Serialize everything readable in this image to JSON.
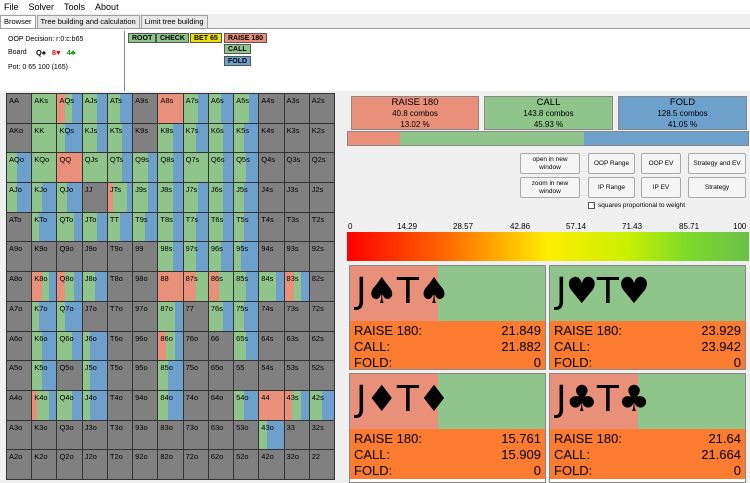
{
  "menu": [
    "File",
    "Solver",
    "Tools",
    "About"
  ],
  "tabs": [
    "Browser",
    "Tree building and calculation",
    "Limit tree building"
  ],
  "info": {
    "decision": "OOP Decision: r:0:c:b65",
    "board_label": "Board",
    "board_cards": [
      {
        "t": "Q♠",
        "c": "b"
      },
      {
        "t": "8♥",
        "c": "r"
      },
      {
        "t": "4♣",
        "c": "g"
      }
    ],
    "pot": "Pot:   0 65 100 (165)"
  },
  "actions": [
    {
      "label": "ROOT",
      "color": "#8fc48a"
    },
    {
      "label": "CHECK",
      "color": "#8fc48a"
    },
    {
      "label": "BET 65",
      "color": "#f0e000"
    },
    {
      "label": "RAISE 180",
      "color": "#e8907a"
    },
    {
      "label": "CALL",
      "color": "#8fc48a"
    },
    {
      "label": "FOLD",
      "color": "#6ea0cc"
    }
  ],
  "summary": [
    {
      "title": "RAISE 180",
      "combos": "40.8 combos",
      "pct": "13.02 %",
      "color": "#e8907a"
    },
    {
      "title": "CALL",
      "combos": "143.8 combos",
      "pct": "45.93 %",
      "color": "#8fc48a"
    },
    {
      "title": "FOLD",
      "combos": "128.5 combos",
      "pct": "41.05 %",
      "color": "#6ea0cc"
    }
  ],
  "mix": [
    {
      "f": 0.13,
      "c": "#e8907a"
    },
    {
      "f": 0.46,
      "c": "#8fc48a"
    },
    {
      "f": 0.41,
      "c": "#6ea0cc"
    }
  ],
  "buttons": {
    "open_new": "open in new window",
    "zoom_new": "zoom in new window",
    "oop_range": "OOP Range",
    "oop_ev": "OOP EV",
    "strategy_ev": "Strategy and EV",
    "ip_range": "IP  Range",
    "ip_ev": "IP  EV",
    "strategy": "Strategy"
  },
  "checkbox": "squares proportional to weight",
  "scale": [
    "0",
    "14.29",
    "28.57",
    "42.86",
    "57.14",
    "71.43",
    "85.71",
    "100"
  ],
  "colors": {
    "raise": "#e8907a",
    "call": "#8fc48a",
    "fold": "#6ea0cc",
    "empty": "#808080"
  },
  "hands": [
    [
      "AA",
      "AKs",
      "AQs",
      "AJs",
      "ATs",
      "A9s",
      "A8s",
      "A7s",
      "A6s",
      "A5s",
      "A4s",
      "A3s",
      "A2s"
    ],
    [
      "AKo",
      "KK",
      "KQs",
      "KJs",
      "KTs",
      "K9s",
      "K8s",
      "K7s",
      "K6s",
      "K5s",
      "K4s",
      "K3s",
      "K2s"
    ],
    [
      "AQo",
      "KQo",
      "QQ",
      "QJs",
      "QTs",
      "Q9s",
      "Q8s",
      "Q7s",
      "Q6s",
      "Q5s",
      "Q4s",
      "Q3s",
      "Q2s"
    ],
    [
      "AJo",
      "KJo",
      "QJo",
      "JJ",
      "JTs",
      "J9s",
      "J8s",
      "J7s",
      "J6s",
      "J5s",
      "J4s",
      "J3s",
      "J2s"
    ],
    [
      "ATo",
      "KTo",
      "QTo",
      "JTo",
      "TT",
      "T9s",
      "T8s",
      "T7s",
      "T6s",
      "T5s",
      "T4s",
      "T3s",
      "T2s"
    ],
    [
      "A9o",
      "K9o",
      "Q9o",
      "J9o",
      "T9o",
      "99",
      "98s",
      "97s",
      "96s",
      "95s",
      "94s",
      "93s",
      "92s"
    ],
    [
      "A8o",
      "K8o",
      "Q8o",
      "J8o",
      "T8o",
      "98o",
      "88",
      "87s",
      "86s",
      "85s",
      "84s",
      "83s",
      "82s"
    ],
    [
      "A7o",
      "K7o",
      "Q7o",
      "J7o",
      "T7o",
      "97o",
      "87o",
      "77",
      "76s",
      "75s",
      "74s",
      "73s",
      "72s"
    ],
    [
      "A6o",
      "K6o",
      "Q6o",
      "J6o",
      "T6o",
      "96o",
      "86o",
      "76o",
      "66",
      "65s",
      "64s",
      "63s",
      "62s"
    ],
    [
      "A5o",
      "K5o",
      "Q5o",
      "J5o",
      "T5o",
      "95o",
      "85o",
      "75o",
      "65o",
      "55",
      "54s",
      "53s",
      "52s"
    ],
    [
      "A4o",
      "K4o",
      "Q4o",
      "J4o",
      "T4o",
      "94o",
      "84o",
      "74o",
      "64o",
      "54o",
      "44",
      "43s",
      "42s"
    ],
    [
      "A3o",
      "K3o",
      "Q3o",
      "J3o",
      "T3o",
      "93o",
      "83o",
      "73o",
      "63o",
      "53o",
      "43o",
      "33",
      "32s"
    ],
    [
      "A2o",
      "K2o",
      "Q2o",
      "J2o",
      "T2o",
      "92o",
      "82o",
      "72o",
      "62o",
      "52o",
      "42o",
      "32o",
      "22"
    ]
  ],
  "cells": {
    "AKs": [
      0,
      1,
      0
    ],
    "AQs": [
      0.3,
      0.3,
      0.4
    ],
    "AJs": [
      0,
      0.6,
      0.4
    ],
    "ATs": [
      0,
      0.5,
      0.5
    ],
    "A8s": [
      1,
      0,
      0
    ],
    "A7s": [
      0,
      0.6,
      0.4
    ],
    "A6s": [
      0,
      0.5,
      0.5
    ],
    "A5s": [
      0,
      0.6,
      0.4
    ],
    "KK": [
      0,
      1,
      0
    ],
    "KQs": [
      0,
      0.3,
      0.7
    ],
    "KJs": [
      0,
      0.6,
      0.4
    ],
    "KTs": [
      0,
      0.6,
      0.4
    ],
    "K8s": [
      0,
      0.6,
      0.4
    ],
    "K7s": [
      0,
      0.5,
      0.5
    ],
    "K6s": [
      0,
      0.6,
      0.4
    ],
    "K5s": [
      0,
      0.4,
      0.6
    ],
    "AQo": [
      0,
      0.4,
      0.6
    ],
    "KQo": [
      0,
      1,
      0
    ],
    "QQ": [
      1,
      0,
      0
    ],
    "QJs": [
      0,
      1,
      0
    ],
    "QTs": [
      0,
      0.6,
      0.4
    ],
    "Q9s": [
      0,
      0.6,
      0.4
    ],
    "Q8s": [
      0,
      0.6,
      0.4
    ],
    "Q7s": [
      0,
      1,
      0
    ],
    "Q6s": [
      0,
      0.6,
      0.4
    ],
    "Q5s": [
      0,
      0.5,
      0.5
    ],
    "AJo": [
      0,
      0.4,
      0.6
    ],
    "KJo": [
      0,
      0.4,
      0.6
    ],
    "QJo": [
      0,
      0.4,
      0.6
    ],
    "JTs": [
      0.2,
      0.6,
      0.2
    ],
    "J9s": [
      0,
      0.6,
      0.4
    ],
    "J8s": [
      0,
      0.6,
      0.4
    ],
    "J7s": [
      0,
      0.6,
      0.4
    ],
    "J6s": [
      0,
      0.6,
      0.4
    ],
    "J5s": [
      0,
      0.4,
      0.6
    ],
    "KTo": [
      0,
      0.3,
      0.7
    ],
    "QTo": [
      0,
      0.7,
      0.3
    ],
    "JTo": [
      0,
      0.6,
      0.4
    ],
    "TT": [
      0,
      0.5,
      0.5
    ],
    "T9s": [
      0,
      0.5,
      0.5
    ],
    "T8s": [
      0,
      0.6,
      0.4
    ],
    "T7s": [
      0,
      0.5,
      0.5
    ],
    "T6s": [
      0,
      0.6,
      0.4
    ],
    "T5s": [
      0,
      0.4,
      0.6
    ],
    "98s": [
      0,
      0.6,
      0.4
    ],
    "97s": [
      0,
      0.5,
      0.5
    ],
    "96s": [
      0,
      0.5,
      0.5
    ],
    "95s": [
      0,
      0.3,
      0.7
    ],
    "K8o": [
      0.4,
      0.3,
      0.3
    ],
    "Q8o": [
      0.3,
      0.4,
      0.3
    ],
    "J8o": [
      0,
      0.5,
      0.5
    ],
    "88": [
      1,
      0,
      0
    ],
    "87s": [
      0.5,
      0.5,
      0
    ],
    "86s": [
      0.4,
      0.6,
      0
    ],
    "85s": [
      0,
      0.5,
      0.5
    ],
    "84s": [
      0,
      0.7,
      0.3
    ],
    "83s": [
      0.4,
      0.3,
      0.3
    ],
    "K7o": [
      0,
      0.3,
      0.7
    ],
    "Q7o": [
      0,
      0.3,
      0.7
    ],
    "87o": [
      0,
      0.7,
      0.3
    ],
    "76s": [
      0,
      0.6,
      0.4
    ],
    "75s": [
      0,
      0.4,
      0.6
    ],
    "K6o": [
      0,
      0.4,
      0.6
    ],
    "Q6o": [
      0,
      0.6,
      0.4
    ],
    "J6o": [
      0,
      0.3,
      0.7
    ],
    "86o": [
      0.3,
      0.4,
      0.3
    ],
    "65s": [
      0,
      0.5,
      0.5
    ],
    "K5o": [
      0,
      0.4,
      0.6
    ],
    "J5o": [
      0,
      0.3,
      0.7
    ],
    "85o": [
      0,
      0.4,
      0.6
    ],
    "K4o": [
      0.2,
      0.5,
      0.3
    ],
    "Q4o": [
      0,
      0.6,
      0.4
    ],
    "J4o": [
      0,
      0.3,
      0.7
    ],
    "84o": [
      0,
      0.4,
      0.6
    ],
    "54o": [
      0,
      0.4,
      0.6
    ],
    "44": [
      1,
      0,
      0
    ],
    "43s": [
      0.3,
      0.4,
      0.3
    ],
    "42s": [
      0,
      0.5,
      0.5
    ],
    "43o": [
      0,
      0.3,
      0.7
    ]
  },
  "combos": [
    {
      "name": "J♠T♠",
      "color": "#000",
      "red": 0.45,
      "rows": [
        [
          "RAISE 180:",
          "21.849"
        ],
        [
          "CALL:",
          "21.882"
        ],
        [
          "FOLD:",
          "0"
        ]
      ]
    },
    {
      "name": "J♥T♥",
      "color": "#000",
      "red": 0.0,
      "rows": [
        [
          "RAISE 180:",
          "23.929"
        ],
        [
          "CALL:",
          "23.942"
        ],
        [
          "FOLD:",
          "0"
        ]
      ]
    },
    {
      "name": "J♦T♦",
      "color": "#000",
      "red": 0.45,
      "rows": [
        [
          "RAISE 180:",
          "15.761"
        ],
        [
          "CALL:",
          "15.909"
        ],
        [
          "FOLD:",
          "0"
        ]
      ]
    },
    {
      "name": "J♣T♣",
      "color": "#000",
      "red": 0.45,
      "rows": [
        [
          "RAISE 180:",
          "21.64"
        ],
        [
          "CALL:",
          "21.664"
        ],
        [
          "FOLD:",
          "0"
        ]
      ]
    }
  ]
}
